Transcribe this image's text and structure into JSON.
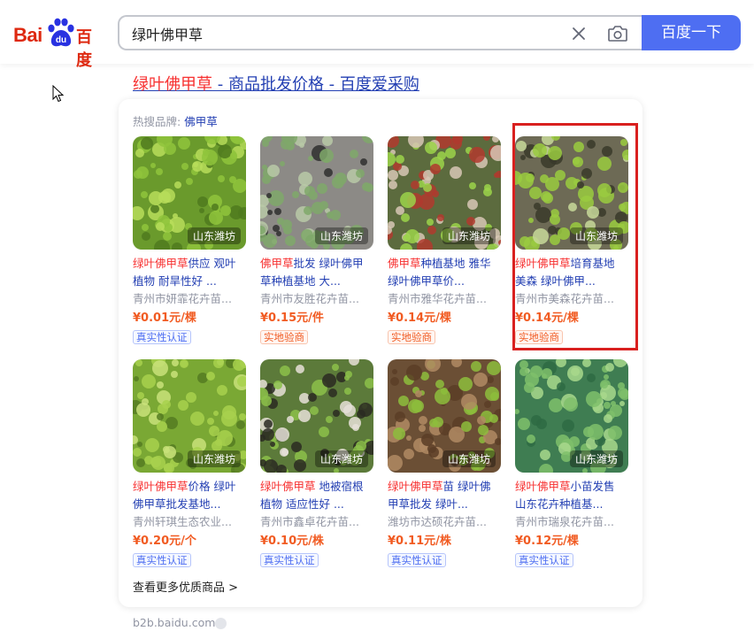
{
  "logo": {
    "latin": "Bai",
    "paw_text": "du",
    "cn": "百度"
  },
  "search": {
    "query": "绿叶佛甲草",
    "button_label": "百度一下"
  },
  "result": {
    "title_keyword": "绿叶佛甲草",
    "title_rest": " - 商品批发价格 - 百度爱采购",
    "hot_brand_label": "热搜品牌:",
    "hot_brand_value": "佛甲草",
    "items": [
      {
        "name_hl": "绿叶佛甲草",
        "name_rest": "供应 观叶植物 耐旱性好 ...",
        "seller": "青州市妍霏花卉苗...",
        "price": "¥0.01元/棵",
        "badge": "真实性认证",
        "badge_type": "blue",
        "location": "山东潍坊"
      },
      {
        "name_hl": "佛甲草",
        "name_rest": "批发 绿叶佛甲草种植基地 大...",
        "seller": "青州市友胜花卉苗...",
        "price": "¥0.15元/件",
        "badge": "实地验商",
        "badge_type": "orange",
        "location": "山东潍坊"
      },
      {
        "name_hl": "佛甲草",
        "name_rest": "种植基地 雅华绿叶佛甲草价...",
        "seller": "青州市雅华花卉苗...",
        "price": "¥0.14元/棵",
        "badge": "实地验商",
        "badge_type": "orange",
        "location": "山东潍坊"
      },
      {
        "name_hl": "绿叶佛甲草",
        "name_rest": "培育基地 美森 绿叶佛甲...",
        "seller": "青州市美森花卉苗...",
        "price": "¥0.14元/棵",
        "badge": "实地验商",
        "badge_type": "orange",
        "location": "山东潍坊"
      },
      {
        "name_hl": "绿叶佛甲草",
        "name_rest": "价格 绿叶佛甲草批发基地...",
        "seller": "青州轩琪生态农业...",
        "price": "¥0.20元/个",
        "badge": "真实性认证",
        "badge_type": "blue",
        "location": "山东潍坊"
      },
      {
        "name_hl": "绿叶佛甲草",
        "name_rest": " 地被宿根植物 适应性好 ...",
        "seller": "青州市鑫卓花卉苗...",
        "price": "¥0.10元/株",
        "badge": "真实性认证",
        "badge_type": "blue",
        "location": "山东潍坊"
      },
      {
        "name_hl": "绿叶佛甲草",
        "name_rest": "苗 绿叶佛甲草批发 绿叶...",
        "seller": "潍坊市达硕花卉苗...",
        "price": "¥0.11元/株",
        "badge": "真实性认证",
        "badge_type": "blue",
        "location": "山东潍坊"
      },
      {
        "name_hl": "绿叶佛甲草",
        "name_rest": "小苗发售 山东花卉种植基...",
        "seller": "青州市瑞泉花卉苗...",
        "price": "¥0.12元/棵",
        "badge": "真实性认证",
        "badge_type": "blue",
        "location": "山东潍坊"
      }
    ],
    "more_link": "查看更多优质商品 >",
    "source_url": "b2b.baidu.com"
  },
  "colors": {
    "brand_red": "#de2910",
    "link_blue": "#2440b3",
    "highlight_red": "#f73131",
    "button_blue": "#4e6ef2",
    "price_orange": "#f15b22"
  }
}
